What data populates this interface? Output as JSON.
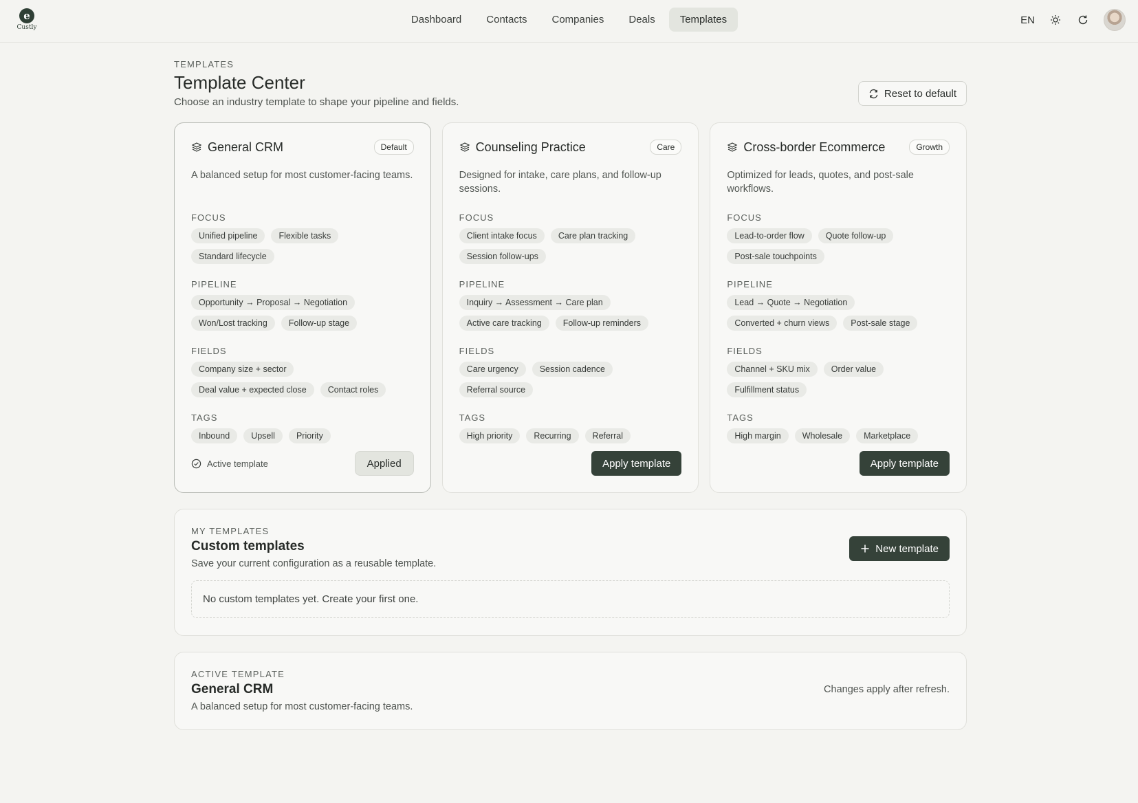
{
  "brand": {
    "name": "Custly"
  },
  "nav": {
    "items": [
      "Dashboard",
      "Contacts",
      "Companies",
      "Deals",
      "Templates"
    ],
    "active_index": 4,
    "language": "EN"
  },
  "header": {
    "eyebrow": "TEMPLATES",
    "title": "Template Center",
    "subtitle": "Choose an industry template to shape your pipeline and fields.",
    "reset_label": "Reset to default"
  },
  "section_labels": {
    "focus": "FOCUS",
    "pipeline": "PIPELINE",
    "fields": "FIELDS",
    "tags": "TAGS"
  },
  "templates": [
    {
      "title": "General CRM",
      "badge": "Default",
      "description": "A balanced setup for most customer-facing teams.",
      "focus": [
        "Unified pipeline",
        "Flexible tasks",
        "Standard lifecycle"
      ],
      "pipeline": [
        "Opportunity → Proposal → Negotiation",
        "Won/Lost tracking",
        "Follow-up stage"
      ],
      "fields": [
        "Company size + sector",
        "Deal value + expected close",
        "Contact roles"
      ],
      "tags": [
        "Inbound",
        "Upsell",
        "Priority"
      ],
      "active": true,
      "active_note": "Active template",
      "button_label": "Applied"
    },
    {
      "title": "Counseling Practice",
      "badge": "Care",
      "description": "Designed for intake, care plans, and follow-up sessions.",
      "focus": [
        "Client intake focus",
        "Care plan tracking",
        "Session follow-ups"
      ],
      "pipeline": [
        "Inquiry → Assessment → Care plan",
        "Active care tracking",
        "Follow-up reminders"
      ],
      "fields": [
        "Care urgency",
        "Session cadence",
        "Referral source"
      ],
      "tags": [
        "High priority",
        "Recurring",
        "Referral"
      ],
      "active": false,
      "button_label": "Apply template"
    },
    {
      "title": "Cross-border Ecommerce",
      "badge": "Growth",
      "description": "Optimized for leads, quotes, and post-sale workflows.",
      "focus": [
        "Lead-to-order flow",
        "Quote follow-up",
        "Post-sale touchpoints"
      ],
      "pipeline": [
        "Lead → Quote → Negotiation",
        "Converted + churn views",
        "Post-sale stage"
      ],
      "fields": [
        "Channel + SKU mix",
        "Order value",
        "Fulfillment status"
      ],
      "tags": [
        "High margin",
        "Wholesale",
        "Marketplace"
      ],
      "active": false,
      "button_label": "Apply template"
    }
  ],
  "my_templates": {
    "eyebrow": "MY TEMPLATES",
    "title": "Custom templates",
    "subtitle": "Save your current configuration as a reusable template.",
    "new_label": "New template",
    "empty_text": "No custom templates yet. Create your first one."
  },
  "active_template": {
    "eyebrow": "ACTIVE TEMPLATE",
    "title": "General CRM",
    "subtitle": "A balanced setup for most customer-facing teams.",
    "note": "Changes apply after refresh."
  },
  "colors": {
    "accent": "#354239",
    "background": "#f4f4f1",
    "card": "#f8f8f6",
    "chip": "#e9eae6"
  },
  "icons": [
    "layers-icon",
    "sun-icon",
    "refresh-icon",
    "check-circle-icon",
    "plus-icon",
    "reset-icon"
  ]
}
